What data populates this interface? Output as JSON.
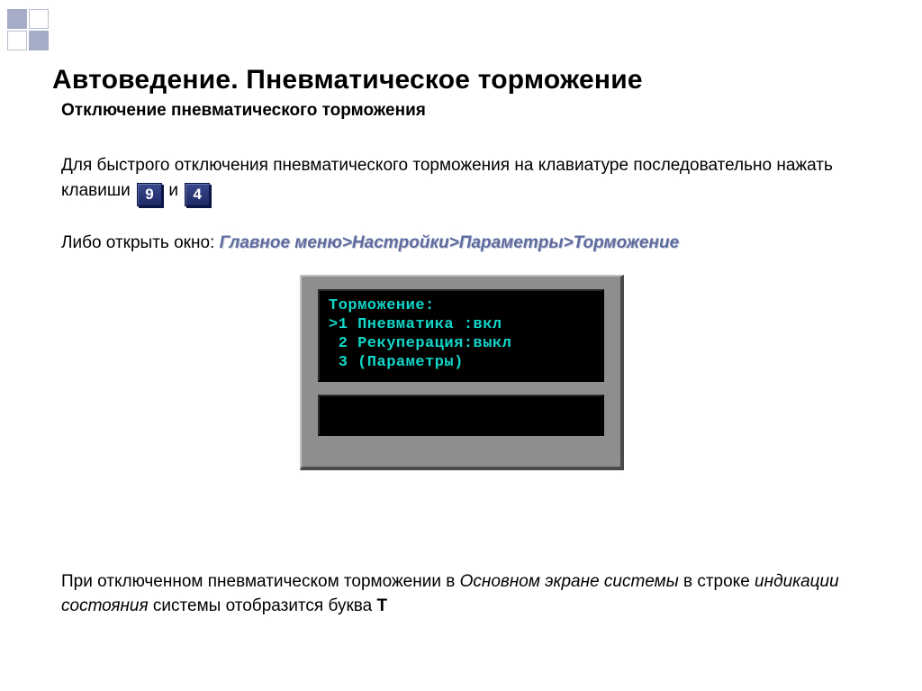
{
  "title": "Автоведение. Пневматическое торможение",
  "subtitle": "Отключение пневматического торможения",
  "instruction": {
    "text_before_keys": "Для быстрого отключения пневматического торможения на клавиатуре последовательно нажать клавиши",
    "key1": "9",
    "between_keys": "и",
    "key2": "4"
  },
  "path_intro": "Либо открыть окно:",
  "menu_path": "Главное меню>Настройки>Параметры>Торможение",
  "screen": {
    "line0": "Торможение:",
    "line1": ">1 Пневматика :вкл",
    "line2": " 2 Рекуперация:выкл",
    "line3": " 3 (Параметры)"
  },
  "footer": {
    "part1": "При отключенном пневматическом торможении в ",
    "italic1": "Основном экране системы",
    "part2": " в строке ",
    "italic2": "индикации состояния",
    "part3": " системы отобразится буква ",
    "bold_letter": "Т"
  }
}
